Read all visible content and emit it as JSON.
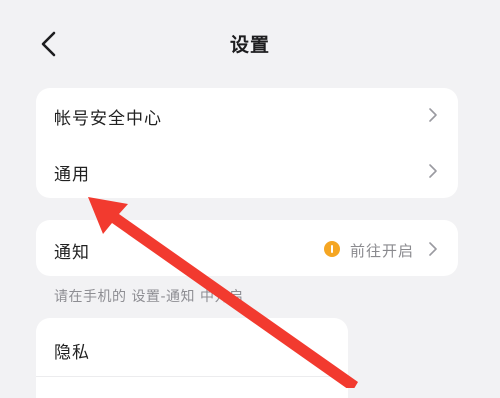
{
  "header": {
    "title": "设置",
    "back_icon": "chevron-left-icon"
  },
  "groups": {
    "account": {
      "items": [
        {
          "label": "帐号安全中心",
          "icon": "chevron-right-icon"
        },
        {
          "label": "通用",
          "icon": "chevron-right-icon"
        }
      ]
    },
    "notification": {
      "label": "通知",
      "status_icon": "info-dot-icon",
      "status_color": "#f5a623",
      "status_text": "前往开启",
      "hint": "请在手机的 设置-通知 中开启"
    },
    "privacy": {
      "label": "隐私"
    }
  },
  "annotation": {
    "arrow_color": "#f23a2f",
    "arrow_target": "通用"
  }
}
